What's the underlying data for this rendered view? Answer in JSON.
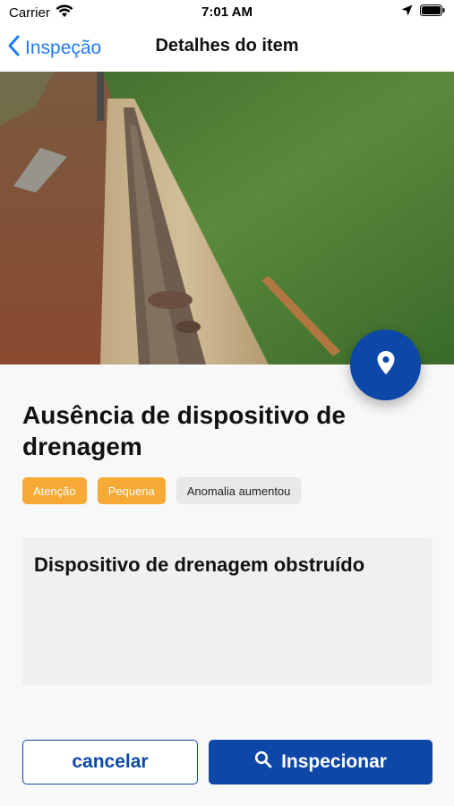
{
  "status_bar": {
    "carrier": "Carrier",
    "time": "7:01 AM",
    "icons": [
      "wifi-icon",
      "location-arrow-icon",
      "battery-icon"
    ]
  },
  "nav": {
    "back_label": "Inspeção",
    "title": "Detalhes do item"
  },
  "hero": {
    "icon": "map-pin-icon"
  },
  "item": {
    "title": "Ausência de dispositivo de drenagem",
    "tags": [
      {
        "label": "Atenção",
        "color": "#f7a935"
      },
      {
        "label": "Pequena",
        "color": "#f7a935"
      },
      {
        "label": "Anomalia aumentou",
        "color": "#e8e8e8"
      }
    ],
    "description": "Dispositivo de drenagem obstruído"
  },
  "actions": {
    "cancel_label": "cancelar",
    "primary_label": "Inspecionar",
    "primary_icon": "search-icon"
  },
  "colors": {
    "accent": "#0d47a8",
    "link": "#1f7bf2",
    "warning": "#f7a935"
  }
}
